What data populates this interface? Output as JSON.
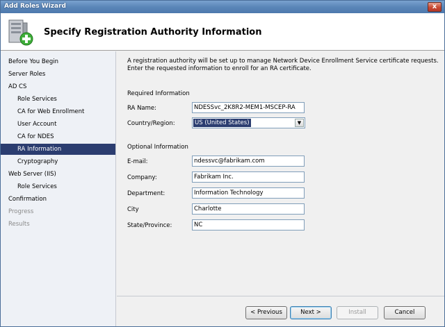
{
  "window": {
    "title": "Add Roles Wizard",
    "close_glyph": "x"
  },
  "header": {
    "title": "Specify Registration Authority Information",
    "icon": "server-roles-icon"
  },
  "sidebar": {
    "items": [
      {
        "label": "Before You Begin",
        "level": "top",
        "state": "normal"
      },
      {
        "label": "Server Roles",
        "level": "top",
        "state": "normal"
      },
      {
        "label": "AD CS",
        "level": "top",
        "state": "normal"
      },
      {
        "label": "Role Services",
        "level": "sub",
        "state": "normal"
      },
      {
        "label": "CA for Web Enrollment",
        "level": "sub",
        "state": "normal"
      },
      {
        "label": "User Account",
        "level": "sub",
        "state": "normal"
      },
      {
        "label": "CA for NDES",
        "level": "sub",
        "state": "normal"
      },
      {
        "label": "RA Information",
        "level": "sub",
        "state": "selected"
      },
      {
        "label": "Cryptography",
        "level": "sub",
        "state": "normal"
      },
      {
        "label": "Web Server (IIS)",
        "level": "top",
        "state": "normal"
      },
      {
        "label": "Role Services",
        "level": "sub",
        "state": "normal"
      },
      {
        "label": "Confirmation",
        "level": "top",
        "state": "normal"
      },
      {
        "label": "Progress",
        "level": "top",
        "state": "disabled"
      },
      {
        "label": "Results",
        "level": "top",
        "state": "disabled"
      }
    ]
  },
  "main": {
    "intro": "A registration authority will be set up to manage Network Device Enrollment Service certificate requests. Enter the requested information to enroll for an RA certificate.",
    "required_label": "Required Information",
    "optional_label": "Optional Information",
    "ra_name": {
      "label": "RA Name:",
      "value": "NDESSvc_2K8R2-MEM1-MSCEP-RA"
    },
    "country": {
      "label": "Country/Region:",
      "value": "US (United States)"
    },
    "email": {
      "label": "E-mail:",
      "value": "ndessvc@fabrikam.com"
    },
    "company": {
      "label": "Company:",
      "value": "Fabrikam Inc."
    },
    "department": {
      "label": "Department:",
      "value": "Information Technology"
    },
    "city": {
      "label": "City",
      "value": "Charlotte"
    },
    "state": {
      "label": "State/Province:",
      "value": "NC"
    }
  },
  "buttons": {
    "previous": "< Previous",
    "next": "Next >",
    "install": "Install",
    "cancel": "Cancel"
  },
  "colors": {
    "selection": "#2b3d70",
    "titlebar": "#5b86b8"
  }
}
